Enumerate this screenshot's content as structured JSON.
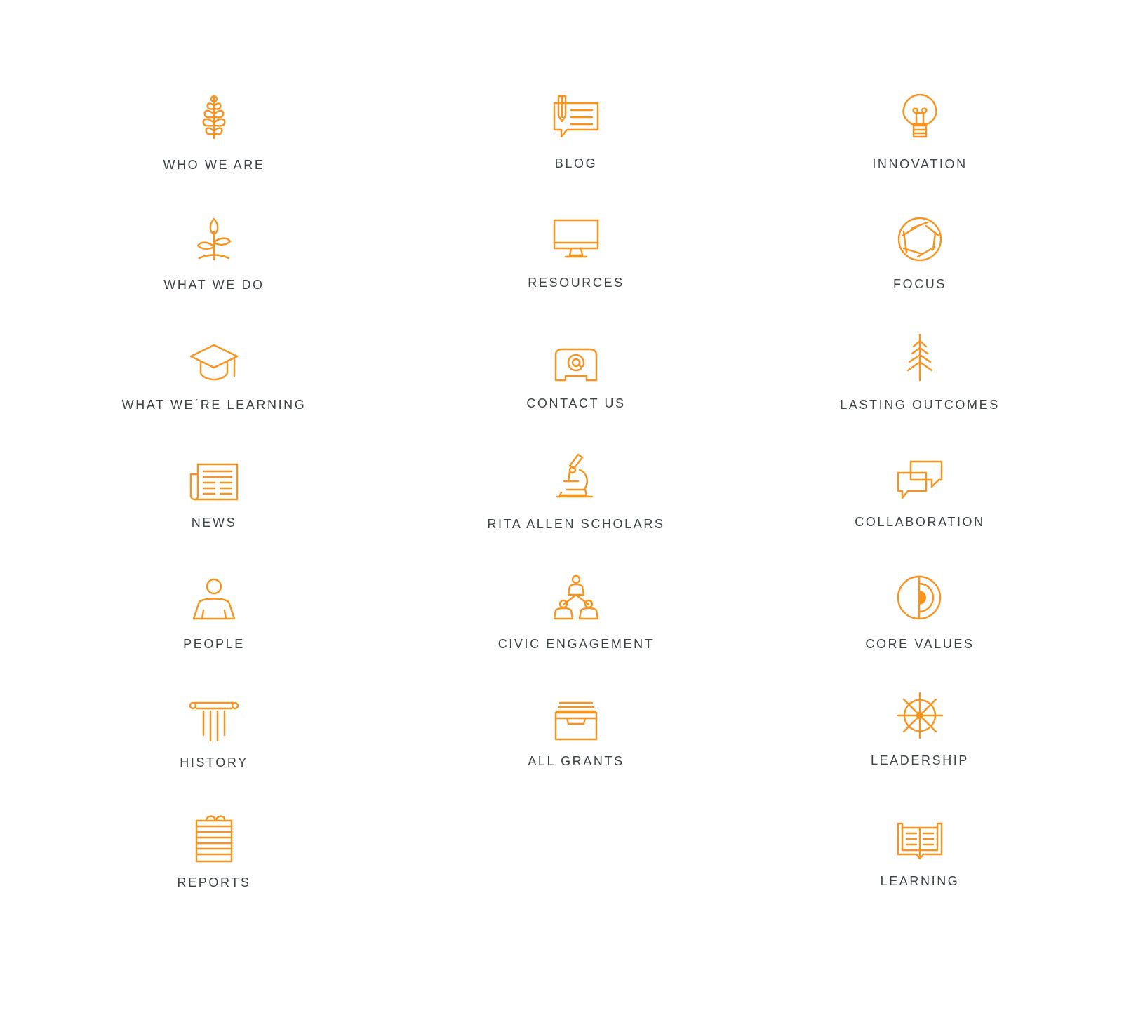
{
  "accent_color": "#f7931e",
  "text_color": "#3d4446",
  "columns": [
    {
      "items": [
        {
          "label": "WHO WE ARE",
          "icon": "pinecone-icon"
        },
        {
          "label": "WHAT WE DO",
          "icon": "sprout-icon"
        },
        {
          "label": "WHAT WE´RE LEARNING",
          "icon": "graduation-cap-icon"
        },
        {
          "label": "NEWS",
          "icon": "newspaper-icon"
        },
        {
          "label": "PEOPLE",
          "icon": "person-icon"
        },
        {
          "label": "HISTORY",
          "icon": "column-icon"
        },
        {
          "label": "REPORTS",
          "icon": "notepad-icon"
        }
      ]
    },
    {
      "items": [
        {
          "label": "BLOG",
          "icon": "speech-pencil-icon"
        },
        {
          "label": "RESOURCES",
          "icon": "monitor-icon"
        },
        {
          "label": "CONTACT US",
          "icon": "email-at-icon"
        },
        {
          "label": "RITA ALLEN SCHOLARS",
          "icon": "microscope-icon"
        },
        {
          "label": "CIVIC ENGAGEMENT",
          "icon": "network-people-icon"
        },
        {
          "label": "ALL GRANTS",
          "icon": "file-drawer-icon"
        }
      ]
    },
    {
      "items": [
        {
          "label": "INNOVATION",
          "icon": "lightbulb-icon"
        },
        {
          "label": "FOCUS",
          "icon": "aperture-icon"
        },
        {
          "label": "LASTING OUTCOMES",
          "icon": "pine-tree-icon"
        },
        {
          "label": "COLLABORATION",
          "icon": "chat-bubbles-icon"
        },
        {
          "label": "CORE VALUES",
          "icon": "core-circle-icon"
        },
        {
          "label": "LEADERSHIP",
          "icon": "ship-wheel-icon"
        },
        {
          "label": "LEARNING",
          "icon": "open-book-icon"
        }
      ]
    }
  ]
}
